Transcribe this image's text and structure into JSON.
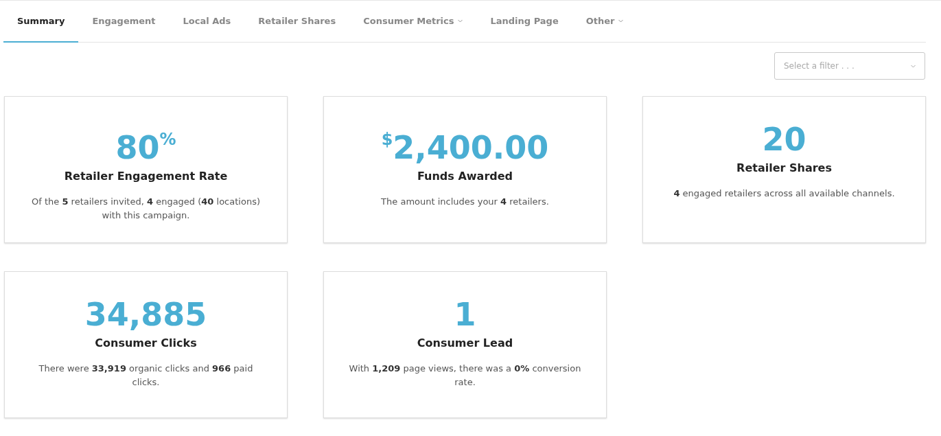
{
  "tabs": [
    {
      "label": "Summary",
      "selected": true,
      "has_menu": false
    },
    {
      "label": "Engagement",
      "selected": false,
      "has_menu": false
    },
    {
      "label": "Local Ads",
      "selected": false,
      "has_menu": false
    },
    {
      "label": "Retailer Shares",
      "selected": false,
      "has_menu": false
    },
    {
      "label": "Consumer Metrics",
      "selected": false,
      "has_menu": true
    },
    {
      "label": "Landing Page",
      "selected": false,
      "has_menu": false
    },
    {
      "label": "Other",
      "selected": false,
      "has_menu": true
    }
  ],
  "filter": {
    "placeholder": "Select a filter . . ."
  },
  "cards": [
    {
      "value": "80$^{%}$",
      "title": "Retailer Engagement Rate",
      "description": "Of the **5** retailers invited, **4** engaged (**40** locations) with this campaign."
    },
    {
      "value": "$^{$}$2,400.00",
      "title": "Funds Awarded",
      "description": "The amount includes your **4** retailers."
    },
    {
      "value": "20",
      "title": "Retailer Shares",
      "description": "**4** engaged retailers across all available channels."
    },
    {
      "value": "34,885",
      "title": "Consumer Clicks",
      "description": "There were **33,919** organic clicks and **966** paid clicks."
    },
    {
      "value": "1",
      "title": "Consumer Lead",
      "description": "With **1,209** page views, there was a **0%** conversion rate."
    }
  ]
}
